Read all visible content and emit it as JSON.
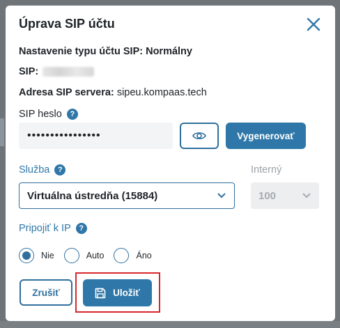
{
  "dialog": {
    "title": "Úprava SIP účtu",
    "close_icon": "close-icon"
  },
  "info": {
    "account_type_label": "Nastavenie typu účtu SIP: Normálny",
    "sip_label": "SIP:",
    "server_label": "Adresa SIP servera:",
    "server_value": "sipeu.kompaas.tech"
  },
  "password": {
    "label": "SIP heslo",
    "value": "••••••••••••••••",
    "show_icon": "eye-icon",
    "generate_label": "Vygenerovať"
  },
  "service": {
    "label": "Služba",
    "value": "Virtuálna ústredňa (15884)"
  },
  "internal": {
    "label": "Interný",
    "value": "100"
  },
  "connect_ip": {
    "label": "Pripojiť k IP",
    "options": [
      "Nie",
      "Auto",
      "Áno"
    ],
    "selected": "Nie"
  },
  "actions": {
    "cancel_label": "Zrušiť",
    "save_label": "Uložiť",
    "save_icon": "save-icon"
  },
  "colors": {
    "accent": "#2f77a8",
    "highlight_frame": "#d7262b"
  }
}
